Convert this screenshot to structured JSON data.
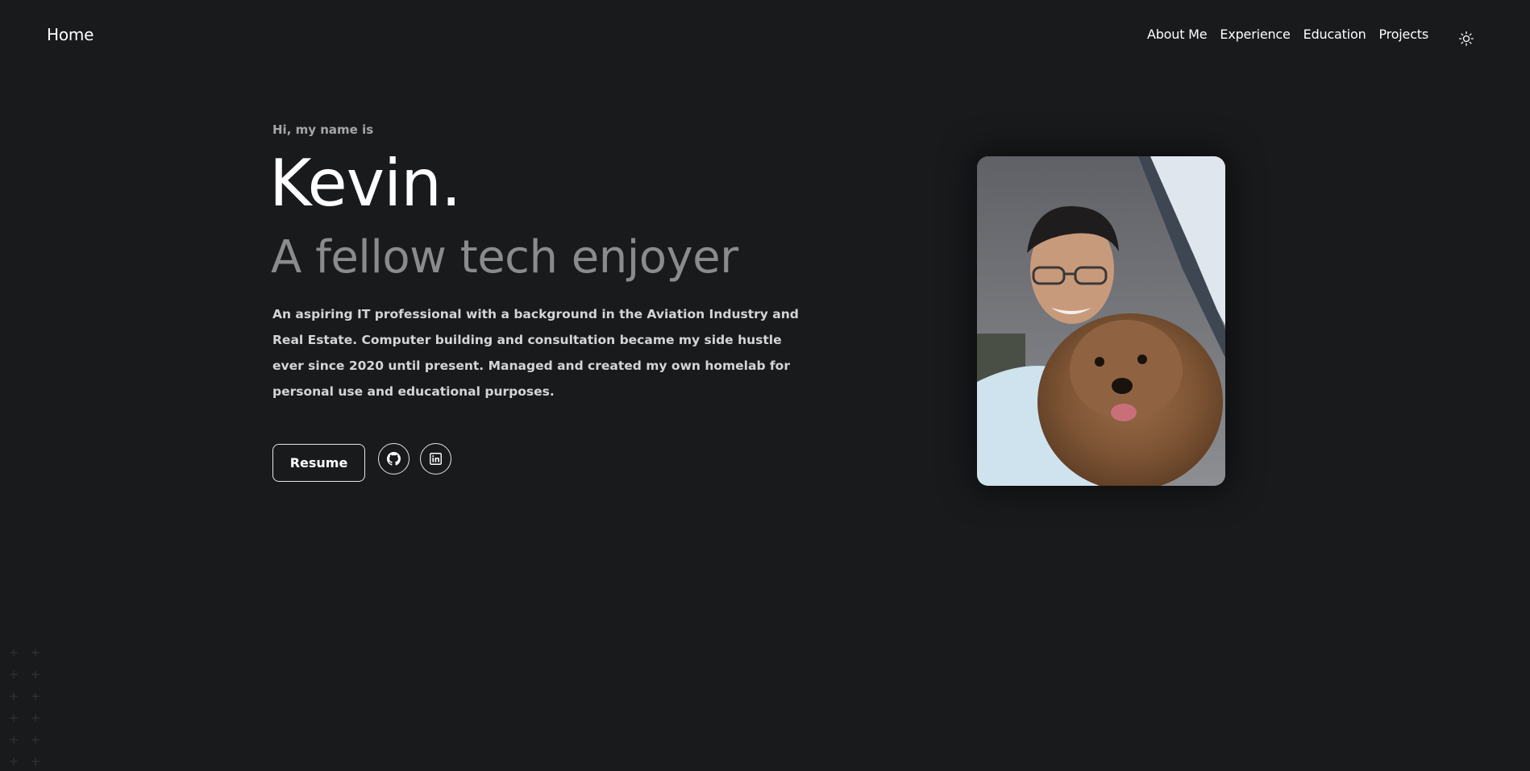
{
  "header": {
    "home_label": "Home",
    "nav_items": [
      {
        "label": "About Me"
      },
      {
        "label": "Experience"
      },
      {
        "label": "Education"
      },
      {
        "label": "Projects"
      }
    ],
    "theme_toggle_icon": "sun-icon"
  },
  "hero": {
    "intro": "Hi, my name is",
    "name": "Kevin.",
    "tagline": "A fellow tech enjoyer",
    "bio": "An aspiring IT professional with a background in the Aviation Industry and Real Estate. Computer building and consultation became my side hustle ever since 2020 until present. Managed and created my own homelab for personal use and educational purposes.",
    "resume_label": "Resume",
    "social": [
      {
        "icon": "github-icon"
      },
      {
        "icon": "linkedin-icon"
      }
    ]
  },
  "colors": {
    "background": "#191a1c",
    "text_primary": "#ffffff",
    "text_muted": "#8a8b8d"
  }
}
